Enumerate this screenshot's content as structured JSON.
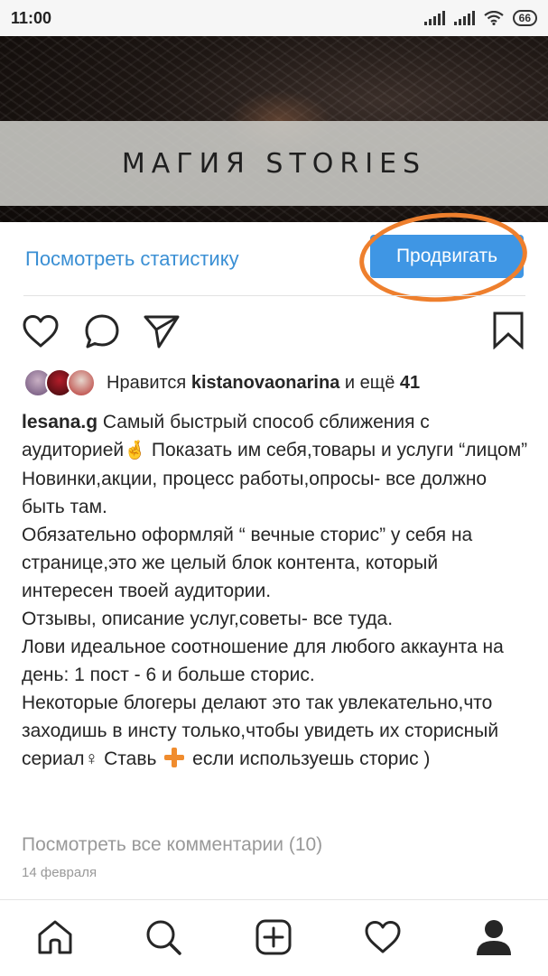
{
  "status_bar": {
    "time": "11:00",
    "battery": "66"
  },
  "post": {
    "banner_text": "МАГИЯ STORIES",
    "view_stats_label": "Посмотреть статистику",
    "promote_label": "Продвигать",
    "likes": {
      "prefix": "Нравится",
      "user": "kistanovaonarina",
      "middle": "и ещё",
      "count": "41"
    },
    "caption": {
      "author": "lesana.g",
      "lines": [
        "Самый быстрый способ сближения с аудиторией",
        "Показать им себя,товары и услуги “лицом”",
        "Новинки,акции, процесс работы,опросы- все должно быть там.",
        "Обязательно оформляй “ вечные сторис” у себя на странице,это же целый блок контента, который интересен твоей аудитории.",
        "Отзывы, описание услуг,советы- все туда.",
        "Лови идеальное соотношение для любого аккаунта на день: 1 пост - 6 и больше сторис.",
        "Некоторые блогеры делают это так увлекательно,что заходишь в инсту только,чтобы увидеть их сторисный сериал",
        "♀ Ставь",
        "если используешь сторис )"
      ]
    },
    "view_comments": "Посмотреть все комментарии (10)",
    "date": "14 февраля"
  },
  "colors": {
    "link": "#3a8fd4",
    "button": "#3f96e4",
    "highlight_oval": "#ee7f2d",
    "muted": "#999999"
  },
  "icons": [
    "heart-icon",
    "comment-icon",
    "share-icon",
    "bookmark-icon",
    "home-icon",
    "search-icon",
    "add-post-icon",
    "activity-heart-icon",
    "profile-icon"
  ]
}
